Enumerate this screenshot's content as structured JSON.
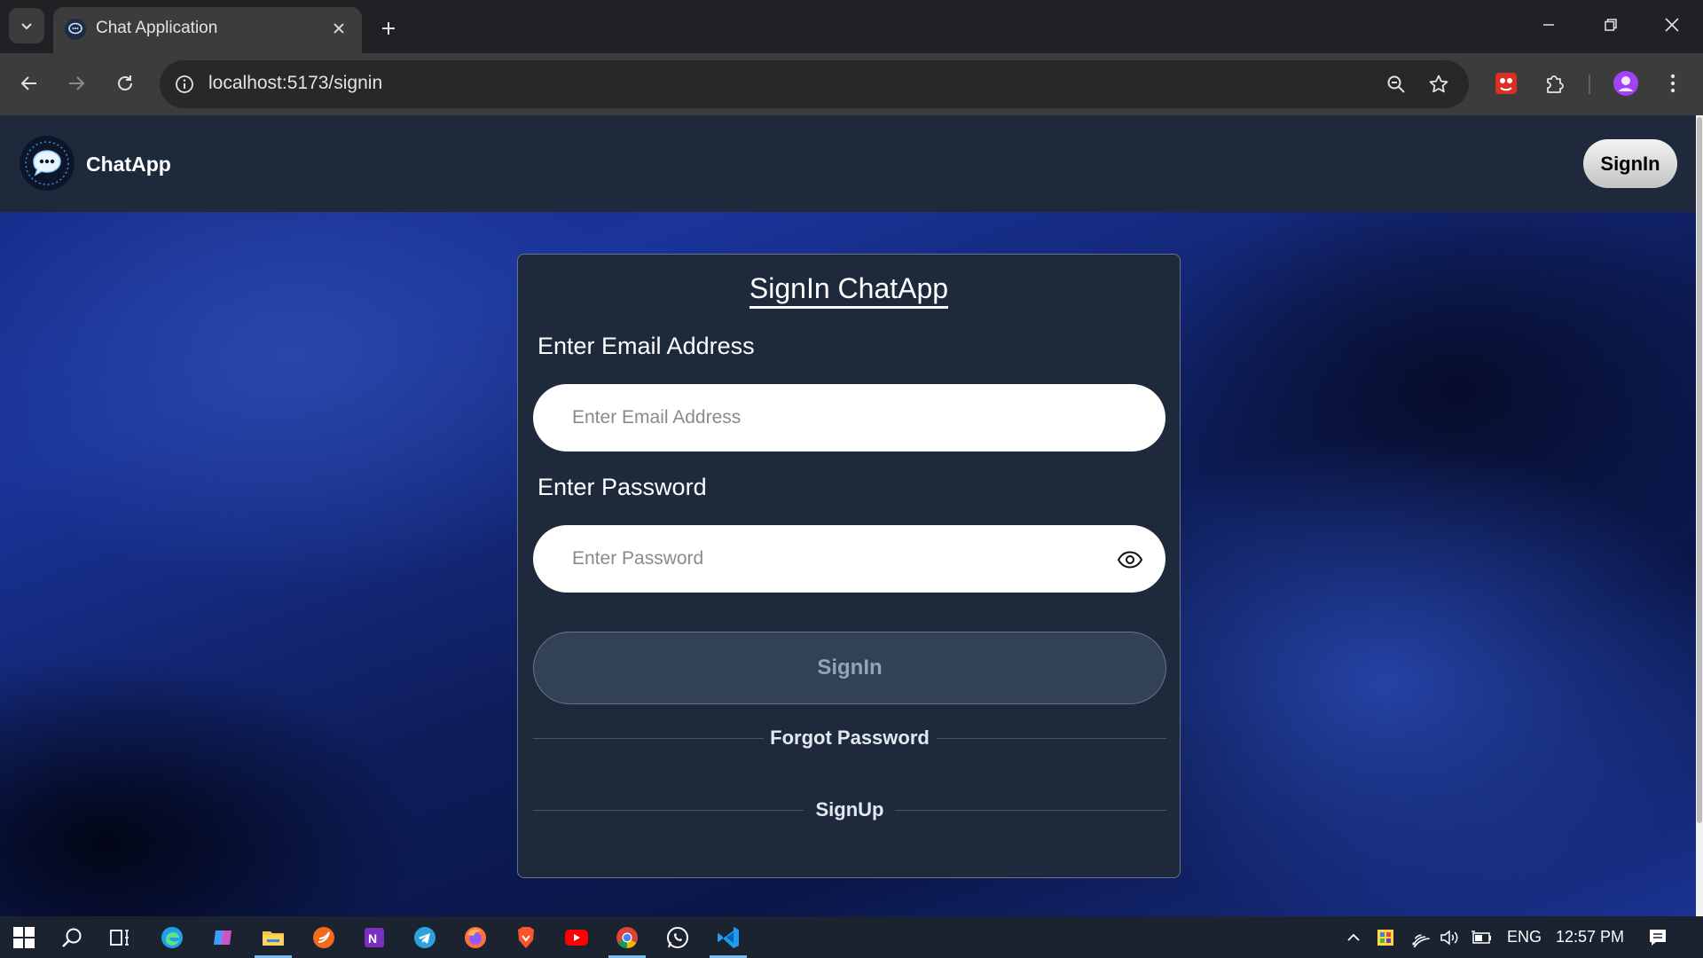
{
  "browser": {
    "tab_title": "Chat Application",
    "url": "localhost:5173/signin"
  },
  "app": {
    "brand": "ChatApp",
    "nav_signin_label": "SignIn"
  },
  "form": {
    "title": "SignIn ChatApp",
    "email_label": "Enter Email Address",
    "email_placeholder": "Enter Email Address",
    "password_label": "Enter Password",
    "password_placeholder": "Enter Password",
    "submit_label": "SignIn",
    "forgot_password_label": "Forgot Password",
    "signup_label": "SignUp"
  },
  "taskbar": {
    "language": "ENG",
    "time": "12:57 PM"
  },
  "colors": {
    "navbar_bg": "#1e293b",
    "card_bg": "#1e293b",
    "button_bg": "#334155",
    "browser_bg": "#3c3c3c"
  }
}
